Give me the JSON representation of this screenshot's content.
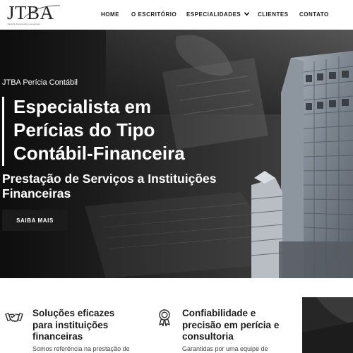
{
  "logo": {
    "mark": "JTBA",
    "tagline": "Perícia Assessoria Consultoria"
  },
  "nav": {
    "items": [
      "HOME",
      "O ESCRITÓRIO",
      "ESPECIALIDADES",
      "CLIENTES",
      "CONTATO"
    ]
  },
  "hero": {
    "eyebrow": "JTBA Perícia Contábil",
    "title_lines": [
      "Especialista em",
      "Perícias do Tipo",
      "Contábil-Financeira"
    ],
    "subtitle_lines": [
      "Prestação de Serviços a Instituições",
      "Financeiras"
    ],
    "button": "SAIBA MAIS"
  },
  "features": [
    {
      "icon": "handshake-icon",
      "title_lines": [
        "Soluções eficazes",
        "para instituições",
        "financeiras"
      ],
      "text": "Somos referência na prestação de"
    },
    {
      "icon": "award-ribbon-icon",
      "title_lines": [
        "Confiabilidade e",
        "precisão em perícia e",
        "consultoria"
      ],
      "text": "Garantidas por uma equipe de"
    }
  ],
  "colors": {
    "primary": "#1b1b1b",
    "hero_text": "#ffffff",
    "background": "#ffffff"
  }
}
